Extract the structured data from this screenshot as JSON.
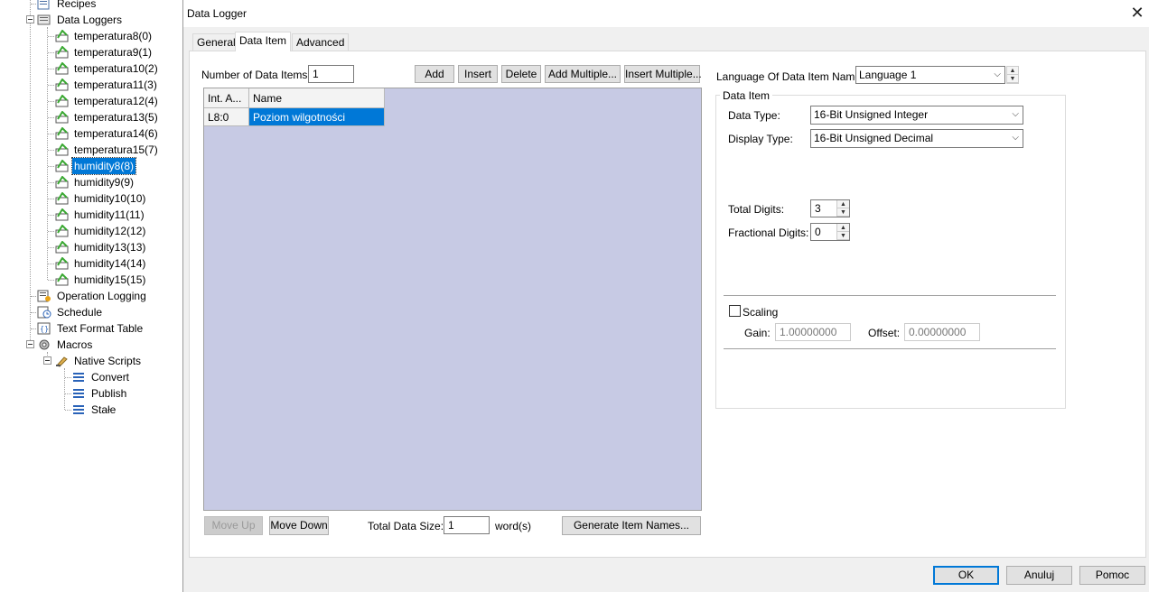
{
  "tree": {
    "items": [
      {
        "label": "Recipes"
      },
      {
        "label": "Data Loggers"
      },
      {
        "label": "temperatura8(0)"
      },
      {
        "label": "temperatura9(1)"
      },
      {
        "label": "temperatura10(2)"
      },
      {
        "label": "temperatura11(3)"
      },
      {
        "label": "temperatura12(4)"
      },
      {
        "label": "temperatura13(5)"
      },
      {
        "label": "temperatura14(6)"
      },
      {
        "label": "temperatura15(7)"
      },
      {
        "label": "humidity8(8)",
        "selected": true
      },
      {
        "label": "humidity9(9)"
      },
      {
        "label": "humidity10(10)"
      },
      {
        "label": "humidity11(11)"
      },
      {
        "label": "humidity12(12)"
      },
      {
        "label": "humidity13(13)"
      },
      {
        "label": "humidity14(14)"
      },
      {
        "label": "humidity15(15)"
      },
      {
        "label": "Operation Logging"
      },
      {
        "label": "Schedule"
      },
      {
        "label": "Text Format Table"
      },
      {
        "label": "Macros"
      },
      {
        "label": "Native Scripts"
      },
      {
        "label": "Convert"
      },
      {
        "label": "Publish"
      },
      {
        "label": "Stałe"
      }
    ]
  },
  "dialog": {
    "title": "Data Logger",
    "close_glyph": "✕",
    "tabs": [
      {
        "label": "General"
      },
      {
        "label": "Data Item",
        "active": true
      },
      {
        "label": "Advanced"
      }
    ],
    "num_items_label": "Number of Data Items:",
    "num_items_value": "1",
    "toolbar": {
      "add": "Add",
      "insert": "Insert",
      "delete": "Delete",
      "add_multiple": "Add Multiple...",
      "insert_multiple": "Insert Multiple..."
    },
    "grid": {
      "columns": [
        "Int. A...",
        "Name"
      ],
      "rows": [
        {
          "addr": "L8:0",
          "name": "Poziom wilgotności"
        }
      ]
    },
    "move_up": "Move Up",
    "move_down": "Move Down",
    "total_size_label": "Total Data Size:",
    "total_size_value": "1",
    "total_size_unit": "word(s)",
    "generate_names": "Generate Item Names...",
    "language_label": "Language Of Data Item Name:",
    "language_value": "Language 1",
    "data_item_group": "Data Item",
    "data_type_label": "Data Type:",
    "data_type_value": "16-Bit Unsigned Integer",
    "display_type_label": "Display Type:",
    "display_type_value": "16-Bit Unsigned Decimal",
    "total_digits_label": "Total Digits:",
    "total_digits_value": "3",
    "fractional_digits_label": "Fractional Digits:",
    "fractional_digits_value": "0",
    "scaling_label": "Scaling",
    "gain_label": "Gain:",
    "gain_value": "1.00000000",
    "offset_label": "Offset:",
    "offset_value": "0.00000000",
    "ok": "OK",
    "cancel": "Anuluj",
    "help": "Pomoc"
  },
  "colors": {
    "selection": "#0078d7",
    "grid_background": "#c7cae4",
    "dialog_background": "#f0f0f0"
  }
}
